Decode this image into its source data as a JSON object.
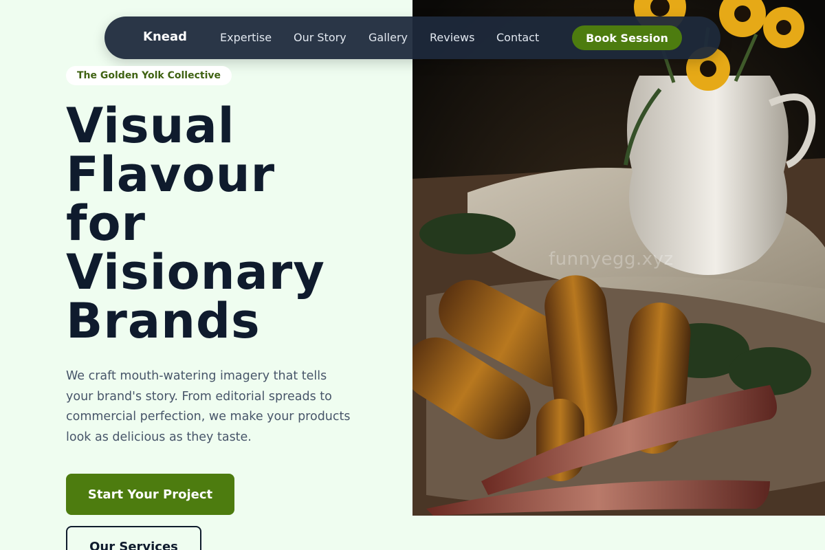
{
  "nav": {
    "brand": "Knead",
    "links": [
      "Expertise",
      "Our Story",
      "Gallery",
      "Reviews",
      "Contact"
    ],
    "cta": "Book Session"
  },
  "hero": {
    "tag": "The Golden Yolk Collective",
    "headline_lines": [
      "Visual",
      "Flavour",
      "for",
      "Visionary",
      "Brands"
    ],
    "description": "We craft mouth-watering imagery that tells your brand's story. From editorial spreads to commercial perfection, we make your products look as delicious as they taste.",
    "primary_cta": "Start Your Project",
    "secondary_cta": "Our Services"
  },
  "photo": {
    "watermark": "funnyegg.xyz",
    "subject": "grilled-corn-with-sunflowers-photo"
  },
  "colors": {
    "accent": "#4d7c0f",
    "nav_bg": "#1e293b",
    "page_bg": "#effdf0",
    "heading": "#0f1b2d"
  }
}
